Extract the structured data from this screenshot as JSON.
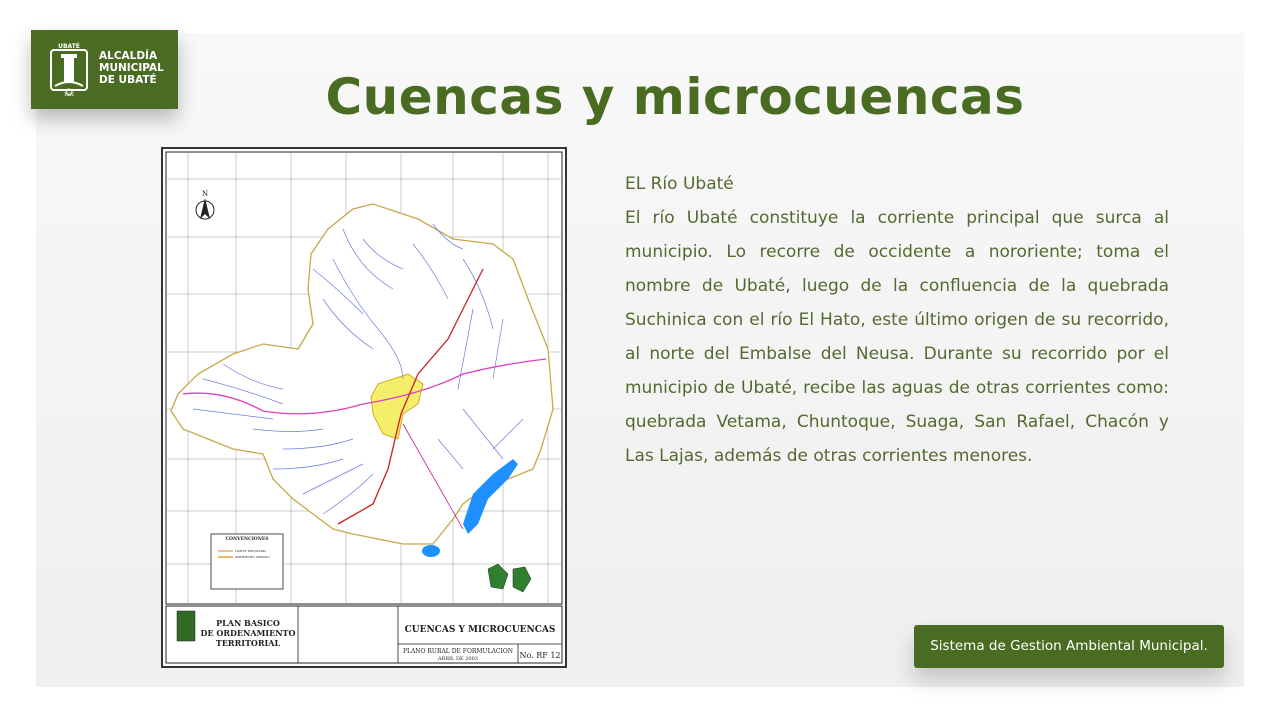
{
  "logo": {
    "emblem_label": "UBATÉ",
    "emblem_year": "1592",
    "lines": [
      "ALCALDÍA",
      "MUNICIPAL",
      "DE UBATÉ"
    ]
  },
  "slide": {
    "title": "Cuencas y microcuencas"
  },
  "content": {
    "heading": "EL Río Ubaté",
    "body": "El río Ubaté constituye la corriente principal que surca al municipio. Lo recorre de occidente a nororiente; toma el nombre de Ubaté, luego de la confluencia de la quebrada Suchinica con el río El Hato, este último origen de su recorrido, al norte del Embalse del Neusa. Durante su recorrido por el municipio de Ubaté, recibe las aguas de otras corrientes como: quebrada Vetama, Chuntoque, Suaga, San Rafael, Chacón y Las Lajas, además de otras corrientes menores."
  },
  "map": {
    "north_label": "N",
    "legend_title": "CONVENCIONES",
    "legend_items": [
      "LIMITE MUNICIPAL",
      "PERIMETRO URBANO"
    ],
    "plan_title_lines": [
      "PLAN BASICO",
      "DE ORDENAMIENTO",
      "TERRITORIAL"
    ],
    "sheet_title": "CUENCAS Y MICROCUENCAS",
    "sheet_subtitle_lines": [
      "PLANO RURAL DE FORMULACION",
      "ABRIL DE 2003"
    ],
    "sheet_number": "No. RF 12"
  },
  "footer": {
    "badge_text": "Sistema de Gestion Ambiental Municipal."
  },
  "colors": {
    "brand_green": "#4a6b22",
    "text_green": "#55692f"
  }
}
